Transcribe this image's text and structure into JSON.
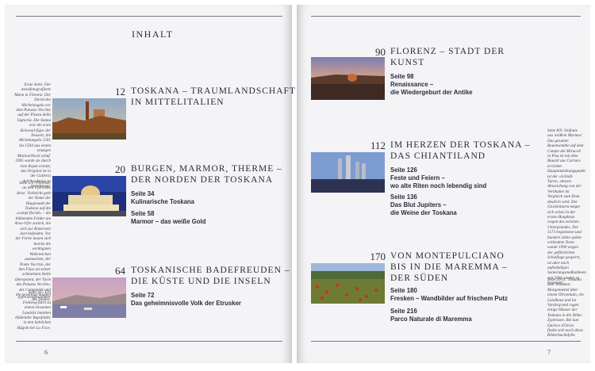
{
  "header": {
    "title": "INHALT"
  },
  "left_chapters": [
    {
      "num": "12",
      "title_1": "TOSKANA – TRAUMLANDSCHAFT",
      "title_2": "IN MITTELITALIEN"
    },
    {
      "num": "20",
      "title_1": "BURGEN, MARMOR, THERME –",
      "title_2": "DER NORDEN DER TOSKANA",
      "sections": [
        {
          "page": "Seite 34",
          "name": "Kulinarische Toskana"
        },
        {
          "page": "Seite 58",
          "name": "Marmor – das weiße Gold"
        }
      ]
    },
    {
      "num": "64",
      "title_1": "TOSKANISCHE BADEFREUDEN –",
      "title_2": "DIE KÜSTE UND DIE INSELN",
      "sections": [
        {
          "page": "Seite 72",
          "name": "Das geheimnisvolle Volk der Etrusker"
        }
      ]
    }
  ],
  "right_chapters": [
    {
      "num": "90",
      "title_1": "FLORENZ – STADT DER",
      "title_2": "KUNST",
      "sections": [
        {
          "page": "Seite 98",
          "name_1": "Renaissance –",
          "name_2": "die Wiedergeburt der Antike"
        }
      ]
    },
    {
      "num": "112",
      "title_1": "IM HERZEN DER TOSKANA –",
      "title_2": "DAS CHIANTILAND",
      "sections": [
        {
          "page": "Seite 126",
          "name_1": "Feste und Feiern –",
          "name_2": "wo alte Riten noch lebendig sind"
        },
        {
          "page": "Seite 136",
          "name_1": "Das Blut Jupiters –",
          "name_2": "die Weine der Toskana"
        }
      ]
    },
    {
      "num": "170",
      "title_1": "VON MONTEPULCIANO",
      "title_2": "BIS IN DIE MAREMMA –",
      "title_3": "DER SÜDEN",
      "sections": [
        {
          "page": "Seite 180",
          "name": "Fresken – Wandbilder auf frischem Putz"
        },
        {
          "page": "Seite 216",
          "name": "Parco Naturale di Maremma"
        }
      ]
    }
  ],
  "left_captions": {
    "c1": "Erste Seite: Der meistfotografierte Mann in Florenz: Der David des Michelangelo vor dem Palazzo Vecchio auf der Piazza della Signoria. Die Statue war die erste Kolossal-figur der Neuzeit; die Michelangelo 1501 bis 1504 aus einem einzigen Marmorblock schuf. 1905 wurde sie durch eine Kopie ersetzt, das Original ist in der Galleria dell'Academia zu besichtigen.",
    "c2": "Seite 2/3: Florenzt, an den Ufern des Arno: Vielleicht geht der Name der Hauptstadt der Toskana auf die »campi floridi« – die blühenden Felder am Arno-Ufer zurück, die sich zur Römerzeit dort befanden. Vor der Ferne lassen sich bereits die wichtigsten Wahrzeichen ausmachen, der Ponte Vecchio, der den Fluss an seiner schmalsten Stelle überspannt, der Turm des Palazzo Vecchio, der Campanile und die gewaltige Kuppel des Domes.",
    "c3": "Seite 4/5: Ein zypressengesäumter Feldweg führt zu einem einsamen Landsitz inmitten blühender Rapsfelder in den lieblichen Hügeln bei La Foce."
  },
  "right_captions": {
    "c1": "Seite 8/9: Sinfonie aus weißem Marmor: Das gesamte Bauensemble auf dem Campo dei Miracoli in Pisa ist mit dem Baustil aus Carrara errichtet. Hauptanziehungspunkt ist der »Schiefe Turm«, dessen Abweichung von der Vertikalen im Vergleich zum Dom deutlich wird. Der Glockenturm neigte sich schon in der ersten Bauphase wegen des weichen Untergrundes. Der 1173 begonnene und hundert Jahre später vollendete Turm wurde 1990 wegen der gefährlichen Schieflage gesperrt, ist aber nach aufwändigen Sanierungsmaßnahmen seit 2001 wieder zu besteigen.",
    "c2": "Seite 10/11: Toskana zum Träumen: Morgennebel über einem Olivenhain, ein Landhaus und im Vordergrund ragen einige Häuser der Toskana in die Höhe: Zypressen. Bei San Quirico d'Orcia findet sich noch diese Bilderbuchidylle."
  },
  "page_numbers": {
    "left": "6",
    "right": "7"
  }
}
